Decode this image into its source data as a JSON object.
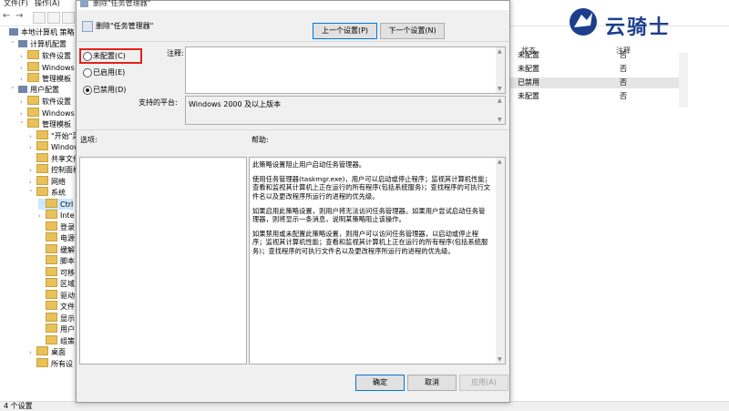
{
  "menubar": {
    "items": [
      "文件(F)",
      "操作(A)"
    ]
  },
  "tree": {
    "items": [
      {
        "label": "本地计算机 策略",
        "type": "pc",
        "indent": 0,
        "chev": ""
      },
      {
        "label": "计算机配置",
        "type": "pc",
        "indent": 1,
        "chev": "˅"
      },
      {
        "label": "软件设置",
        "type": "folder",
        "indent": 2,
        "chev": "›"
      },
      {
        "label": "Windows 设",
        "type": "folder",
        "indent": 2,
        "chev": "›"
      },
      {
        "label": "管理模板",
        "type": "folder",
        "indent": 2,
        "chev": "›"
      },
      {
        "label": "用户配置",
        "type": "pc",
        "indent": 1,
        "chev": "˅"
      },
      {
        "label": "软件设置",
        "type": "folder",
        "indent": 2,
        "chev": "›"
      },
      {
        "label": "Windows 设",
        "type": "folder",
        "indent": 2,
        "chev": "›"
      },
      {
        "label": "管理模板",
        "type": "folder",
        "indent": 2,
        "chev": "˅"
      },
      {
        "label": "\"开始\"菜",
        "type": "folder",
        "indent": 3,
        "chev": "›"
      },
      {
        "label": "Windows",
        "type": "folder",
        "indent": 3,
        "chev": "›"
      },
      {
        "label": "共享文件",
        "type": "folder",
        "indent": 3,
        "chev": ""
      },
      {
        "label": "控制面板",
        "type": "folder",
        "indent": 3,
        "chev": "›"
      },
      {
        "label": "网络",
        "type": "folder",
        "indent": 3,
        "chev": "›"
      },
      {
        "label": "系统",
        "type": "folder",
        "indent": 3,
        "chev": "˅"
      },
      {
        "label": "Ctrl",
        "type": "folder",
        "indent": 4,
        "chev": "",
        "selected": true
      },
      {
        "label": "Inte",
        "type": "folder",
        "indent": 4,
        "chev": "›"
      },
      {
        "label": "登录",
        "type": "folder",
        "indent": 4,
        "chev": ""
      },
      {
        "label": "电源",
        "type": "folder",
        "indent": 4,
        "chev": ""
      },
      {
        "label": "缓解",
        "type": "folder",
        "indent": 4,
        "chev": ""
      },
      {
        "label": "脚本",
        "type": "folder",
        "indent": 4,
        "chev": ""
      },
      {
        "label": "可移",
        "type": "folder",
        "indent": 4,
        "chev": ""
      },
      {
        "label": "区域",
        "type": "folder",
        "indent": 4,
        "chev": ""
      },
      {
        "label": "驱动",
        "type": "folder",
        "indent": 4,
        "chev": ""
      },
      {
        "label": "文件",
        "type": "folder",
        "indent": 4,
        "chev": ""
      },
      {
        "label": "显示",
        "type": "folder",
        "indent": 4,
        "chev": ""
      },
      {
        "label": "用户",
        "type": "folder",
        "indent": 4,
        "chev": ""
      },
      {
        "label": "组策",
        "type": "folder",
        "indent": 4,
        "chev": ""
      },
      {
        "label": "桌面",
        "type": "folder",
        "indent": 3,
        "chev": "›"
      },
      {
        "label": "所有设",
        "type": "folder",
        "indent": 3,
        "chev": ""
      }
    ]
  },
  "rightpane": {
    "col_state": "状态",
    "col_note": "注释",
    "rows": [
      {
        "state": "未配置",
        "note": "否"
      },
      {
        "state": "未配置",
        "note": "否"
      },
      {
        "state": "已禁用",
        "note": "否",
        "selected": true
      },
      {
        "state": "未配置",
        "note": "否"
      }
    ]
  },
  "logo": {
    "text": "云骑士"
  },
  "statusbar": {
    "text": "4 个设置"
  },
  "dialog": {
    "window_title": "删除\"任务管理器\"",
    "header_title": "删除\"任务管理器\"",
    "prev_button": "上一个设置(P)",
    "next_button": "下一个设置(N)",
    "radio_not_configured": "未配置(C)",
    "radio_enabled": "已启用(E)",
    "radio_disabled": "已禁用(D)",
    "selected_option": "disabled",
    "comment_label": "注释:",
    "supported_label": "支持的平台:",
    "supported_value": "Windows 2000 及以上版本",
    "options_label": "选项:",
    "help_label": "帮助:",
    "help_paragraphs": [
      "此策略设置阻止用户启动任务管理器。",
      "使用任务管理器(taskmgr.exe)，用户可以启动或停止程序；监视其计算机性能；查看和监视其计算机上正在运行的所有程序(包括系统服务)；查找程序的可执行文件名以及更改程序所运行的进程的优先级。",
      "如果启用此策略设置，则用户将无法访问任务管理器。如果用户尝试启动任务管理器，则将显示一条消息，说明某策略阻止该操作。",
      "如果禁用或未配置此策略设置，则用户可以访问任务管理器，以启动或停止程序；监视其计算机性能；查看和监视其计算机上正在运行的所有程序(包括系统服务)；查找程序的可执行文件名以及更改程序所运行的进程的优先级。"
    ],
    "ok_button": "确定",
    "cancel_button": "取消",
    "apply_button": "应用(A)"
  },
  "colors": {
    "highlight": "#e0241b",
    "selection": "#cce8ff",
    "accent": "#0078d7"
  }
}
